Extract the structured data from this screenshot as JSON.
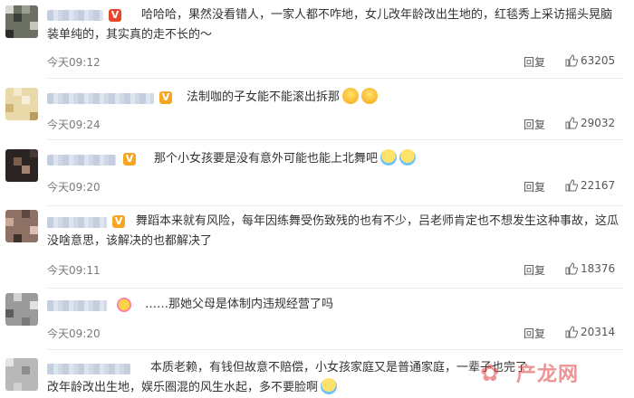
{
  "comments": [
    {
      "badge": "V",
      "text": "哈哈哈，果然没看错人，一家人都不咋地，女儿改年龄改出生地的，红毯秀上采访摇头晃脑装单纯的，其实真的走不长的～",
      "time": "今天09:12",
      "reply": "回复",
      "likes": "63205"
    },
    {
      "badge": "V",
      "text": "法制咖的子女能不能滚出拆那",
      "time": "今天09:24",
      "reply": "回复",
      "likes": "29032"
    },
    {
      "badge": "V",
      "text": "那个小女孩要是没有意外可能也能上北舞吧",
      "time": "今天09:20",
      "reply": "回复",
      "likes": "22167"
    },
    {
      "badge": "V",
      "text": "舞蹈本来就有风险，每年因练舞受伤致残的也有不少，吕老师肯定也不想发生这种事故，这瓜没啥意思，该解决的也都解决了",
      "time": "今天09:11",
      "reply": "回复",
      "likes": "18376"
    },
    {
      "badge": "",
      "text": "……那她父母是体制内违规经营了吗",
      "time": "今天09:20",
      "reply": "回复",
      "likes": "20314"
    },
    {
      "badge": "",
      "text": "本质老赖，有钱但故意不赔偿，小女孩家庭又是普通家庭，一辈子也完了",
      "text2": "改年龄改出生地，娱乐圈混的风生水起，多不要脸啊"
    }
  ],
  "watermark": "产龙网",
  "colors": {
    "badge_orange": "#f5a623",
    "badge_red": "#e8462b",
    "text": "#333333",
    "meta": "#7a7a7a"
  }
}
